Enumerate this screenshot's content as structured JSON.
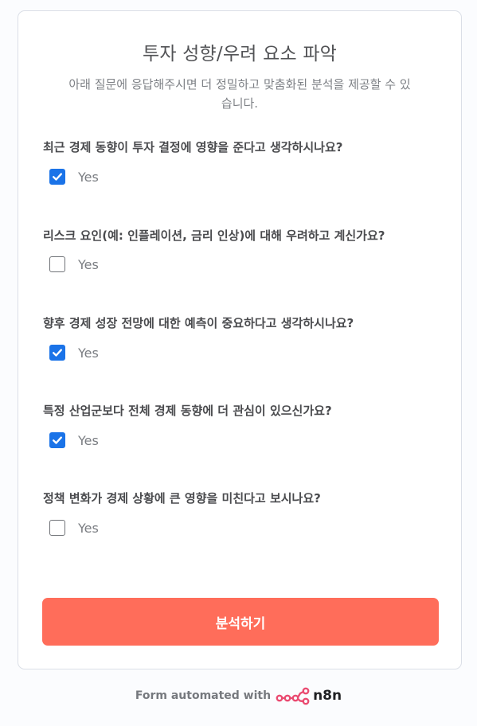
{
  "form": {
    "title": "투자 성향/우려 요소 파악",
    "subtitle": "아래 질문에 응답해주시면 더 정밀하고 맞춤화된 분석을 제공할 수 있습니다.",
    "questions": [
      {
        "label": "최근 경제 동향이 투자 결정에 영향을 준다고 생각하시나요?",
        "option": "Yes",
        "checked": true
      },
      {
        "label": "리스크 요인(예: 인플레이션, 금리 인상)에 대해 우려하고 계신가요?",
        "option": "Yes",
        "checked": false
      },
      {
        "label": "향후 경제 성장 전망에 대한 예측이 중요하다고 생각하시나요?",
        "option": "Yes",
        "checked": true
      },
      {
        "label": "특정 산업군보다 전체 경제 동향에 더 관심이 있으신가요?",
        "option": "Yes",
        "checked": true
      },
      {
        "label": "정책 변화가 경제 상황에 큰 영향을 미친다고 보시나요?",
        "option": "Yes",
        "checked": false
      }
    ],
    "submit_label": "분석하기"
  },
  "footer": {
    "text": "Form automated with",
    "logo_text": "n8n",
    "logo_icon": "n8n-logo-icon"
  },
  "colors": {
    "accent": "#ff6d5a",
    "checkbox": "#1a73e8",
    "logo": "#ea4b71"
  }
}
